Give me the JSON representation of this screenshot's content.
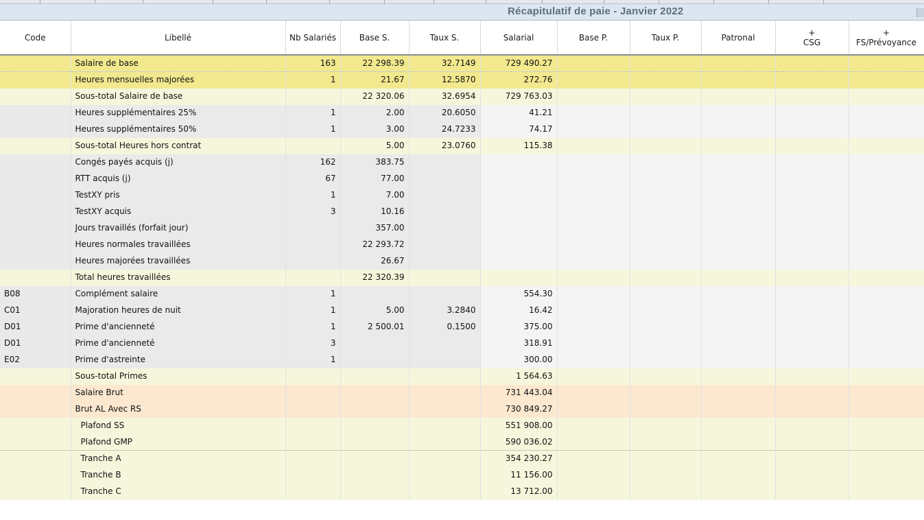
{
  "title": "Récapitulatif de paie - Janvier 2022",
  "columns": [
    "Code",
    "Libellé",
    "Nb Salariés",
    "Base S.",
    "Taux S.",
    "Salarial",
    "Base P.",
    "Taux P.",
    "Patronal",
    "+\nCSG",
    "+\nFS/Prévoyance"
  ],
  "rows": [
    {
      "type": "hl",
      "code": "",
      "lib": "Salaire de base",
      "nb": "163",
      "base": "22 298.39",
      "taux": "32.7149",
      "sal": "729 490.27"
    },
    {
      "type": "hl",
      "code": "",
      "lib": "Heures mensuelles majorées",
      "nb": "1",
      "base": "21.67",
      "taux": "12.5870",
      "sal": "272.76"
    },
    {
      "type": "sub",
      "code": "",
      "lib": "Sous-total Salaire de base",
      "nb": "",
      "base": "22 320.06",
      "taux": "32.6954",
      "sal": "729 763.03"
    },
    {
      "type": "norm",
      "code": "",
      "lib": "Heures supplémentaires 25%",
      "nb": "1",
      "base": "2.00",
      "taux": "20.6050",
      "sal": "41.21"
    },
    {
      "type": "norm",
      "code": "",
      "lib": "Heures supplémentaires 50%",
      "nb": "1",
      "base": "3.00",
      "taux": "24.7233",
      "sal": "74.17"
    },
    {
      "type": "sub",
      "code": "",
      "lib": "Sous-total Heures hors contrat",
      "nb": "",
      "base": "5.00",
      "taux": "23.0760",
      "sal": "115.38"
    },
    {
      "type": "norm",
      "code": "",
      "lib": "Congés payés acquis (j)",
      "nb": "162",
      "base": "383.75",
      "taux": "",
      "sal": ""
    },
    {
      "type": "norm",
      "code": "",
      "lib": "RTT acquis (j)",
      "nb": "67",
      "base": "77.00",
      "taux": "",
      "sal": ""
    },
    {
      "type": "norm",
      "code": "",
      "lib": "TestXY pris",
      "nb": "1",
      "base": "7.00",
      "taux": "",
      "sal": ""
    },
    {
      "type": "norm",
      "code": "",
      "lib": "TestXY acquis",
      "nb": "3",
      "base": "10.16",
      "taux": "",
      "sal": ""
    },
    {
      "type": "norm",
      "code": "",
      "lib": "Jours travaillés (forfait jour)",
      "nb": "",
      "base": "357.00",
      "taux": "",
      "sal": ""
    },
    {
      "type": "norm",
      "code": "",
      "lib": "Heures normales travaillées",
      "nb": "",
      "base": "22 293.72",
      "taux": "",
      "sal": ""
    },
    {
      "type": "norm",
      "code": "",
      "lib": "Heures majorées travaillées",
      "nb": "",
      "base": "26.67",
      "taux": "",
      "sal": ""
    },
    {
      "type": "sub",
      "code": "",
      "lib": "Total heures travaillées",
      "nb": "",
      "base": "22 320.39",
      "taux": "",
      "sal": ""
    },
    {
      "type": "norm",
      "code": "B08",
      "lib": "Complément salaire",
      "nb": "1",
      "base": "",
      "taux": "",
      "sal": "554.30"
    },
    {
      "type": "norm",
      "code": "C01",
      "lib": "Majoration heures de nuit",
      "nb": "1",
      "base": "5.00",
      "taux": "3.2840",
      "sal": "16.42"
    },
    {
      "type": "norm",
      "code": "D01",
      "lib": "Prime d'ancienneté",
      "nb": "1",
      "base": "2 500.01",
      "taux": "0.1500",
      "sal": "375.00"
    },
    {
      "type": "norm",
      "code": "D01",
      "lib": "Prime d'ancienneté",
      "nb": "3",
      "base": "",
      "taux": "",
      "sal": "318.91"
    },
    {
      "type": "norm",
      "code": "E02",
      "lib": "Prime d'astreinte",
      "nb": "1",
      "base": "",
      "taux": "",
      "sal": "300.00"
    },
    {
      "type": "sub",
      "code": "",
      "lib": "Sous-total Primes",
      "nb": "",
      "base": "",
      "taux": "",
      "sal": "1 564.63"
    },
    {
      "type": "brut",
      "code": "",
      "lib": "Salaire Brut",
      "nb": "",
      "base": "",
      "taux": "",
      "sal": "731 443.04"
    },
    {
      "type": "brut",
      "code": "",
      "lib": "Brut AL Avec RS",
      "nb": "",
      "base": "",
      "taux": "",
      "sal": "730 849.27"
    },
    {
      "type": "plaf",
      "code": "",
      "lib": "Plafond SS",
      "nb": "",
      "base": "",
      "taux": "",
      "sal": "551 908.00",
      "indent": true
    },
    {
      "type": "plaf",
      "code": "",
      "lib": "Plafond GMP",
      "nb": "",
      "base": "",
      "taux": "",
      "sal": "590 036.02",
      "indent": true
    },
    {
      "type": "plaf",
      "code": "",
      "lib": "Tranche A",
      "nb": "",
      "base": "",
      "taux": "",
      "sal": "354 230.27",
      "indent": true,
      "sep": true
    },
    {
      "type": "plaf",
      "code": "",
      "lib": "Tranche B",
      "nb": "",
      "base": "",
      "taux": "",
      "sal": "11 156.00",
      "indent": true
    },
    {
      "type": "plaf",
      "code": "",
      "lib": "Tranche C",
      "nb": "",
      "base": "",
      "taux": "",
      "sal": "13 712.00",
      "indent": true
    }
  ]
}
